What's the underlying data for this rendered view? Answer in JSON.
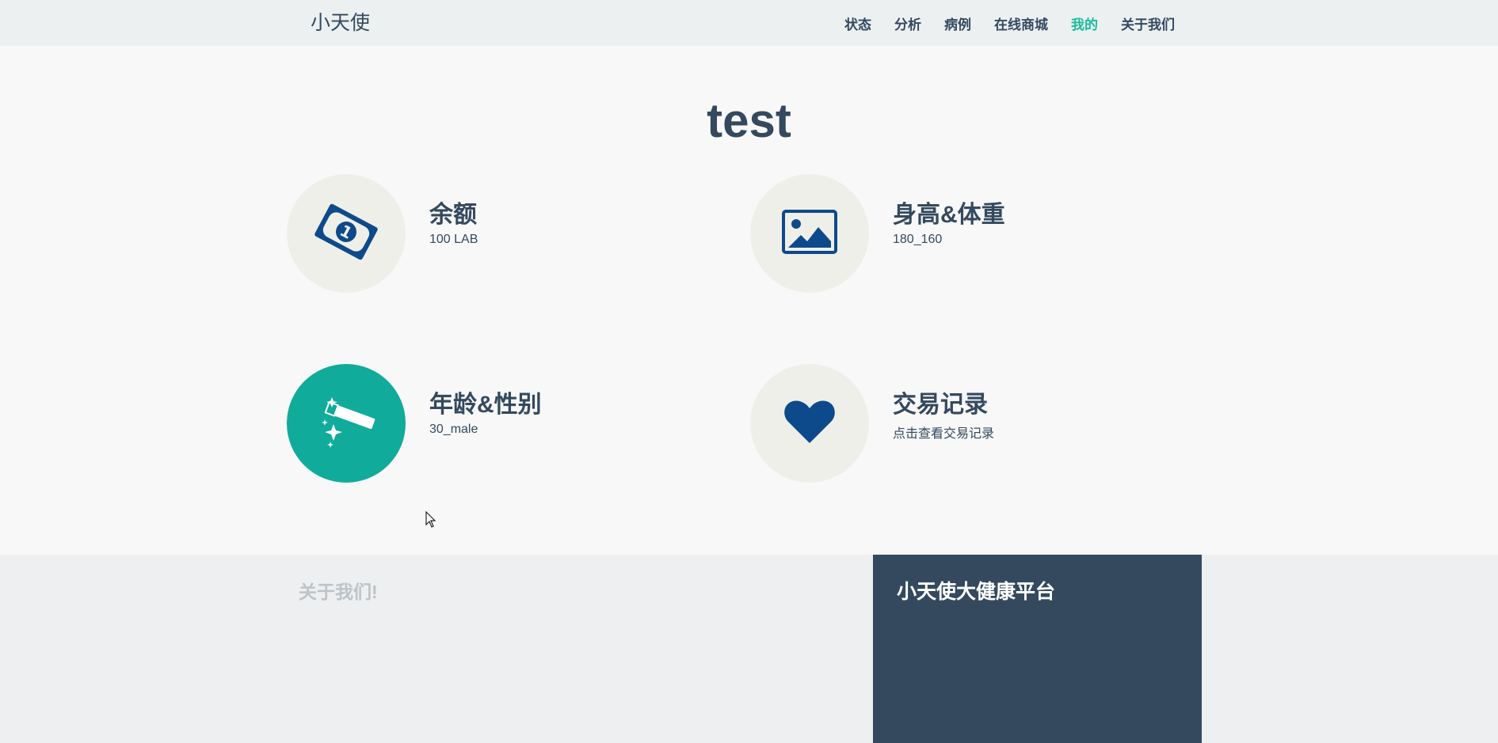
{
  "navbar": {
    "brand": "小天使",
    "items": [
      {
        "label": "状态"
      },
      {
        "label": "分析"
      },
      {
        "label": "病例"
      },
      {
        "label": "在线商城"
      },
      {
        "label": "我的",
        "active": true
      },
      {
        "label": "关于我们"
      }
    ]
  },
  "main": {
    "title": "test",
    "features": [
      {
        "title": "余额",
        "subtitle": "100 LAB",
        "icon": "money-bill-icon"
      },
      {
        "title": "身高&体重",
        "subtitle": "180_160",
        "icon": "image-icon"
      },
      {
        "title": "年龄&性别",
        "subtitle": "30_male",
        "icon": "magic-wand-icon"
      },
      {
        "title": "交易记录",
        "subtitle": "点击查看交易记录",
        "icon": "heart-icon"
      }
    ]
  },
  "footer": {
    "about_title": "关于我们!",
    "panel_title": "小天使大健康平台"
  },
  "colors": {
    "accent": "#1abc9c",
    "text": "#34495e",
    "icon_blue": "#0d4a8b",
    "navbar_bg": "#ecf0f1",
    "panel_bg": "#34495e"
  }
}
